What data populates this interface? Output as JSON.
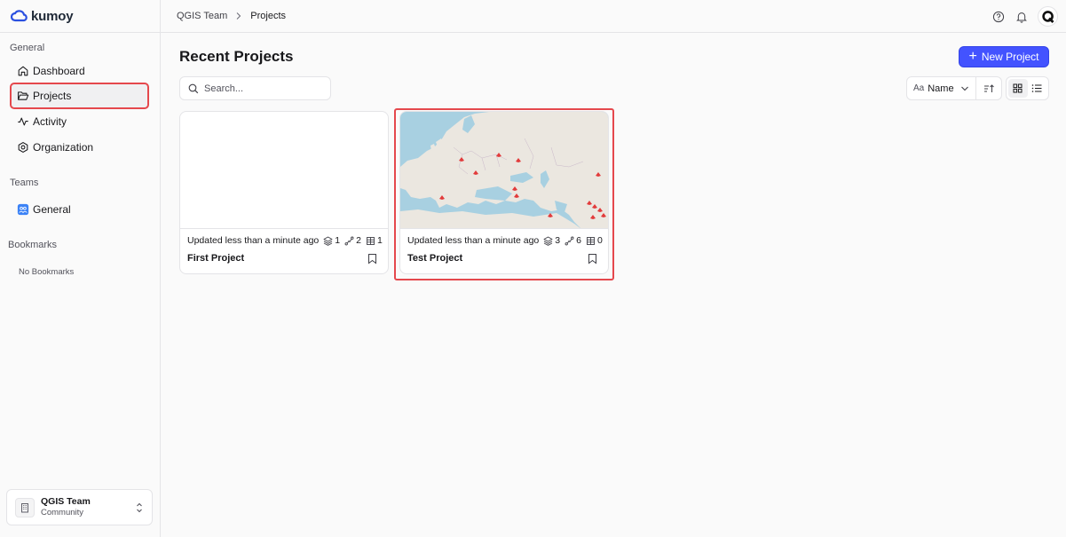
{
  "brand": {
    "name": "kumoy",
    "accent": "#4353ff",
    "highlight": "#e5484d"
  },
  "sidebar": {
    "general_label": "General",
    "items": [
      {
        "label": "Dashboard",
        "icon": "home-icon"
      },
      {
        "label": "Projects",
        "icon": "folder-open-icon",
        "active": true
      },
      {
        "label": "Activity",
        "icon": "activity-icon"
      },
      {
        "label": "Organization",
        "icon": "organization-icon"
      }
    ],
    "teams_label": "Teams",
    "teams": [
      {
        "label": "General",
        "icon": "team-icon"
      }
    ],
    "bookmarks_label": "Bookmarks",
    "no_bookmarks": "No Bookmarks",
    "team_switcher": {
      "name": "QGIS Team",
      "plan": "Community"
    }
  },
  "topbar": {
    "breadcrumb": [
      "QGIS Team",
      "Projects"
    ],
    "avatar_letter": "Q"
  },
  "main": {
    "title": "Recent Projects",
    "new_project_label": "New Project",
    "search_placeholder": "Search...",
    "sort": {
      "prefix": "Aa",
      "value": "Name"
    },
    "view_mode": "grid"
  },
  "projects": [
    {
      "name": "First Project",
      "updated": "Updated less than a minute ago",
      "layers": "1",
      "maps": "2",
      "tables": "1",
      "thumbnail": "blank"
    },
    {
      "name": "Test Project",
      "updated": "Updated less than a minute ago",
      "layers": "3",
      "maps": "6",
      "tables": "0",
      "thumbnail": "map-europe"
    }
  ]
}
